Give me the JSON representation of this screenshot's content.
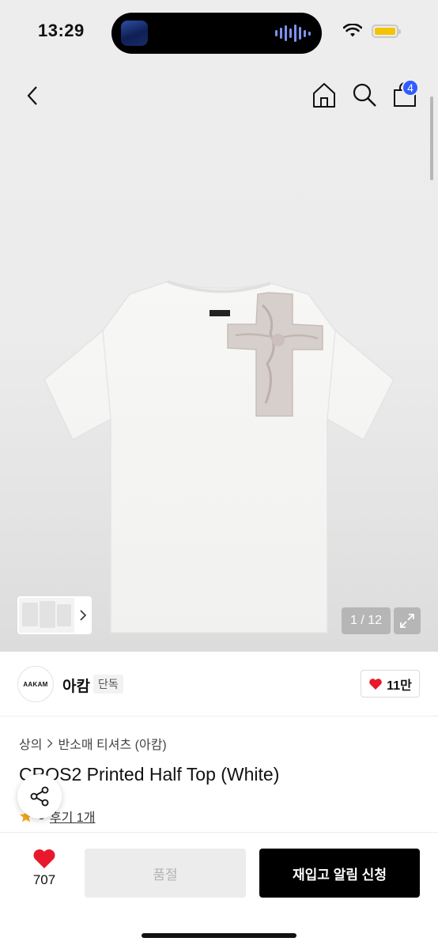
{
  "status_bar": {
    "time": "13:29",
    "icons": [
      "wifi-icon",
      "battery-icon"
    ],
    "battery_color": "#f4c400"
  },
  "nav": {
    "back_icon": "chevron-left-icon",
    "home_icon": "home-icon",
    "search_icon": "search-icon",
    "bag_icon": "shopping-bag-icon",
    "cart_count": "4",
    "badge_color": "#2f5bff"
  },
  "gallery": {
    "page_counter": "1 / 12",
    "expand_icon": "expand-icon",
    "thumb_arrow_icon": "chevron-right-icon"
  },
  "brand": {
    "logo_text": "AAKAM",
    "name": "아캄",
    "badge": "단독",
    "likes": "11만",
    "heart_color": "#e8192c"
  },
  "product": {
    "breadcrumb": [
      "상의",
      "반소매 티셔츠 (아캄)"
    ],
    "title": "CROS2 Printed Half Top (White)",
    "rating": "5",
    "review_link": "후기 1개",
    "star_color": "#f5a623"
  },
  "bottom_bar": {
    "wish_count": "707",
    "soldout_label": "품절",
    "restock_label": "재입고 알림 신청"
  }
}
